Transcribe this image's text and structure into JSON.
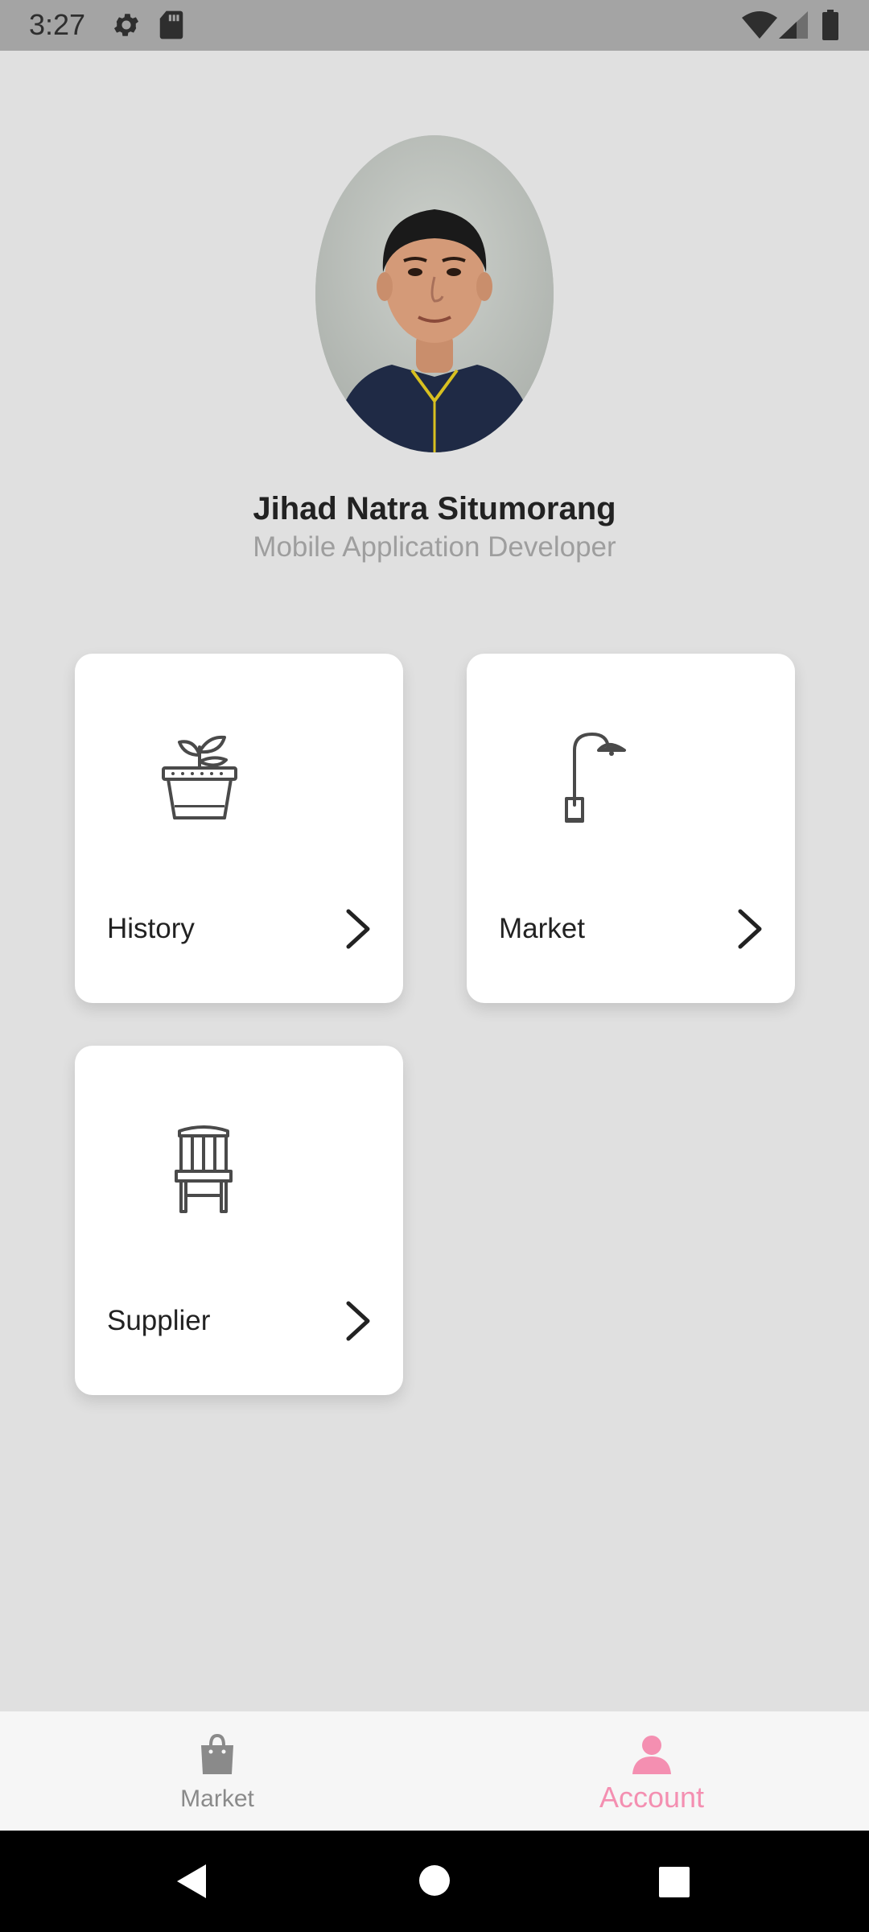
{
  "status_bar": {
    "time": "3:27",
    "icons": [
      "gear-icon",
      "sd-card-icon",
      "wifi-icon",
      "signal-icon",
      "battery-icon"
    ]
  },
  "profile": {
    "name": "Jihad Natra Situmorang",
    "role": "Mobile Application Developer",
    "avatar_icon": "profile-photo"
  },
  "menu": {
    "cards": [
      {
        "label": "History",
        "icon": "plant-pot-icon"
      },
      {
        "label": "Market",
        "icon": "street-lamp-icon"
      },
      {
        "label": "Supplier",
        "icon": "chair-icon"
      }
    ]
  },
  "bottom_nav": {
    "items": [
      {
        "label": "Market",
        "icon": "shopping-bag-icon",
        "active": false
      },
      {
        "label": "Account",
        "icon": "person-icon",
        "active": true
      }
    ]
  },
  "colors": {
    "background": "#e0e0e0",
    "accent": "#f48fb1",
    "inactive": "#8a8a8a",
    "status_bar": "#a4a4a4"
  }
}
